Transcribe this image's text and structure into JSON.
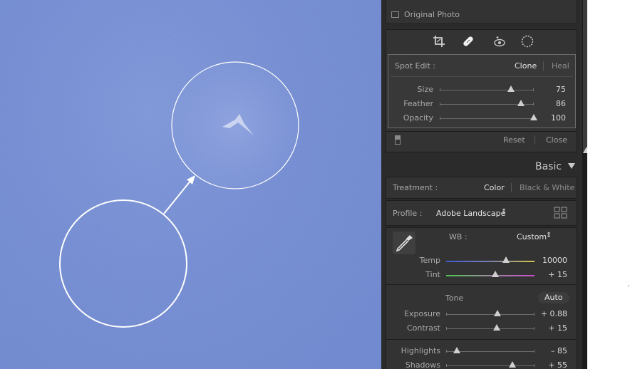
{
  "original_photo": {
    "label": "Original Photo"
  },
  "tools": [
    "crop-icon",
    "heal-brush-icon",
    "red-eye-icon",
    "radial-filter-icon"
  ],
  "spot_edit": {
    "label": "Spot Edit :",
    "mode_clone": "Clone",
    "mode_heal": "Heal",
    "sliders": [
      {
        "label": "Size",
        "value": "75",
        "position": 0.76
      },
      {
        "label": "Feather",
        "value": "86",
        "position": 0.86
      },
      {
        "label": "Opacity",
        "value": "100",
        "position": 1.0
      }
    ],
    "reset": "Reset",
    "close": "Close"
  },
  "basic": {
    "title": "Basic",
    "treatment_label": "Treatment :",
    "treatment_color": "Color",
    "treatment_bw": "Black & White",
    "profile_label": "Profile :",
    "profile_value": "Adobe Landscape",
    "profile_arrows": "⇕",
    "wb_label": "WB :",
    "wb_value": "Custom",
    "wb_arrows": "⇕",
    "temp": {
      "label": "Temp",
      "value": "10000",
      "position": 0.68
    },
    "tint": {
      "label": "Tint",
      "value": "+ 15",
      "position": 0.56
    },
    "tone_label": "Tone",
    "auto": "Auto",
    "exposure": {
      "label": "Exposure",
      "value": "+ 0.88",
      "position": 0.58
    },
    "contrast": {
      "label": "Contrast",
      "value": "+ 15",
      "position": 0.57
    },
    "highlights": {
      "label": "Highlights",
      "value": "– 85",
      "position": 0.12
    },
    "shadows": {
      "label": "Shadows",
      "value": "+ 55",
      "position": 0.75
    }
  },
  "colors": {
    "photo_sky": "#7089d0",
    "panel_bg": "#2b2b2b",
    "box_bg": "#333333",
    "circle_stroke": "#ffffff"
  }
}
